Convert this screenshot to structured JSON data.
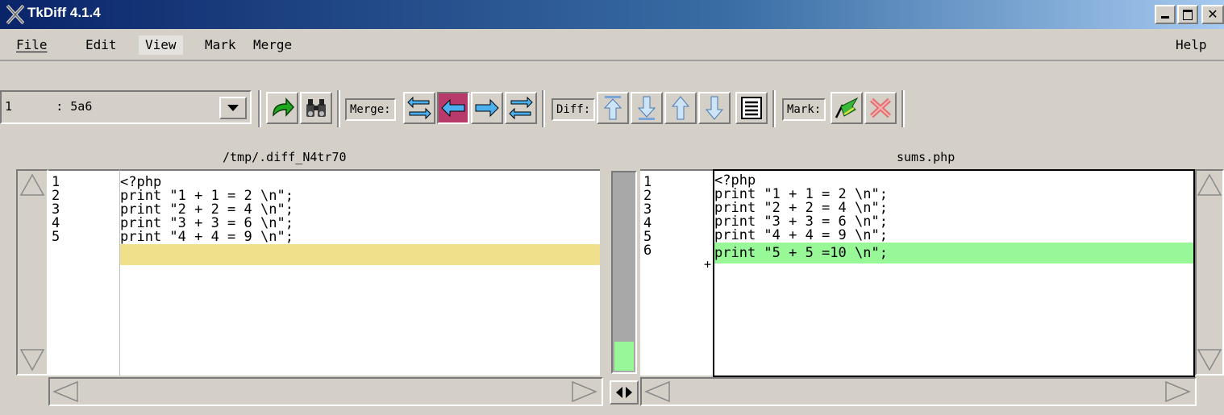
{
  "window": {
    "title": "TkDiff 4.1.4",
    "controls": [
      "minimize",
      "maximize",
      "close"
    ]
  },
  "menu": {
    "items": [
      "File",
      "Edit",
      "View",
      "Mark",
      "Merge"
    ],
    "help": "Help"
  },
  "toolbar": {
    "diff_select": "1      : 5a6",
    "merge_label": "Merge:",
    "diff_label": "Diff:",
    "mark_label": "Mark:"
  },
  "left": {
    "filename": "/tmp/.diff_N4tr70",
    "line_numbers": [
      "1",
      "2",
      "3",
      "4",
      "5"
    ],
    "lines": [
      "<?php",
      "print \"1 + 1 = 2 \\n\";",
      "print \"2 + 2 = 4 \\n\";",
      "print \"3 + 3 = 6 \\n\";",
      "print \"4 + 4 = 9 \\n\";"
    ]
  },
  "right": {
    "filename": "sums.php",
    "line_numbers": [
      "1",
      "2",
      "3",
      "4",
      "5",
      "6"
    ],
    "lines": [
      "<?php",
      "print \"1 + 1 = 2 \\n\";",
      "print \"2 + 2 = 4 \\n\";",
      "print \"3 + 3 = 6 \\n\";",
      "print \"4 + 4 = 9 \\n\";",
      "print \"5 + 5 =10 \\n\";"
    ],
    "added_marker": "+"
  },
  "colors": {
    "removed_bg": "#f0e08c",
    "added_bg": "#98f898",
    "title_start": "#0a246a",
    "title_end": "#a6caf0"
  }
}
